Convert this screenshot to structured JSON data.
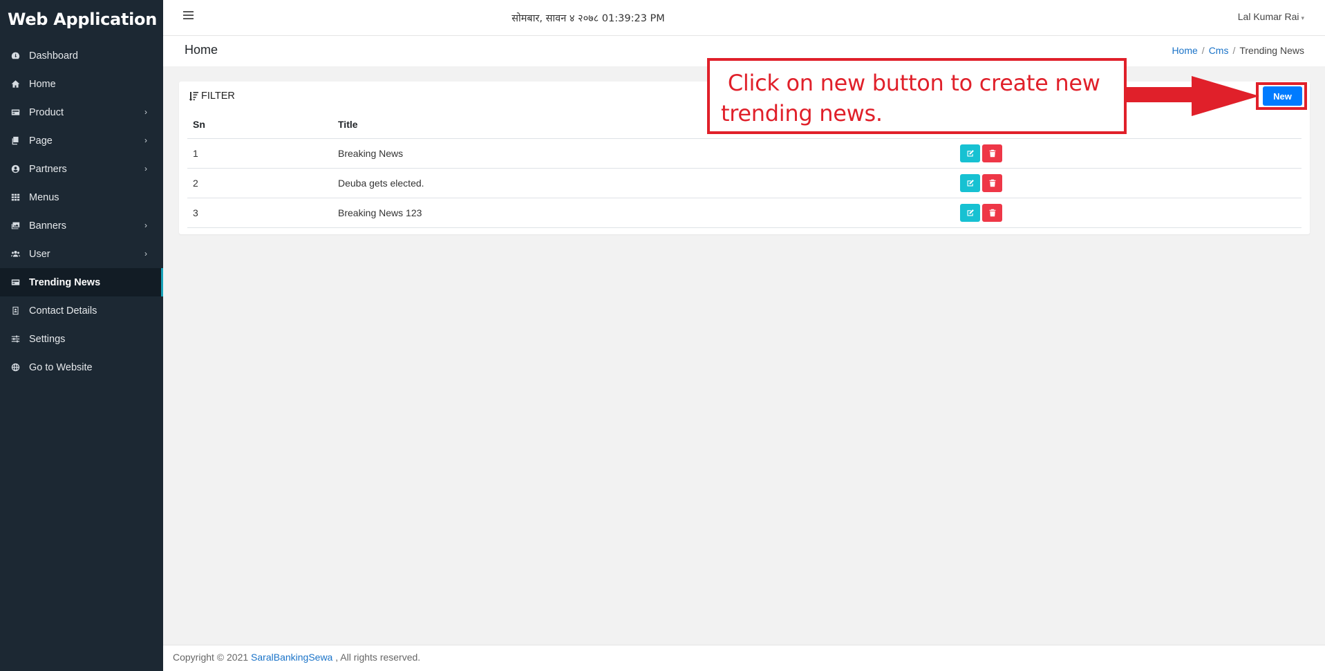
{
  "app": {
    "title": "Web Application"
  },
  "sidebar": {
    "items": [
      {
        "label": "Dashboard",
        "icon": "dashboard-icon",
        "has_children": false,
        "active": false
      },
      {
        "label": "Home",
        "icon": "home-icon",
        "has_children": false,
        "active": false
      },
      {
        "label": "Product",
        "icon": "product-icon",
        "has_children": true,
        "active": false
      },
      {
        "label": "Page",
        "icon": "page-icon",
        "has_children": true,
        "active": false
      },
      {
        "label": "Partners",
        "icon": "partners-icon",
        "has_children": true,
        "active": false
      },
      {
        "label": "Menus",
        "icon": "menus-icon",
        "has_children": false,
        "active": false
      },
      {
        "label": "Banners",
        "icon": "banners-icon",
        "has_children": true,
        "active": false
      },
      {
        "label": "User",
        "icon": "users-icon",
        "has_children": true,
        "active": false
      },
      {
        "label": "Trending News",
        "icon": "news-icon",
        "has_children": false,
        "active": true
      },
      {
        "label": "Contact Details",
        "icon": "contact-icon",
        "has_children": false,
        "active": false
      },
      {
        "label": "Settings",
        "icon": "settings-icon",
        "has_children": false,
        "active": false
      },
      {
        "label": "Go to Website",
        "icon": "globe-icon",
        "has_children": false,
        "active": false
      }
    ]
  },
  "topbar": {
    "datetime": "सोमबार, सावन ४ २०७८ 01:39:23 PM",
    "user": "Lal Kumar Rai"
  },
  "header": {
    "title": "Home",
    "breadcrumb": {
      "home": "Home",
      "cms": "Cms",
      "current": "Trending News"
    }
  },
  "card": {
    "filter_label": "FILTER",
    "new_button": "New",
    "table": {
      "headers": {
        "sn": "Sn",
        "title": "Title"
      },
      "rows": [
        {
          "sn": "1",
          "title": "Breaking News"
        },
        {
          "sn": "2",
          "title": "Deuba gets elected."
        },
        {
          "sn": "3",
          "title": "Breaking News 123"
        }
      ]
    }
  },
  "annotation": {
    "line1": " Click on new button to create new",
    "line2": "trending news."
  },
  "footer": {
    "prefix": "Copyright © 2021 ",
    "link": "SaralBankingSewa",
    "suffix": " , All rights reserved."
  },
  "colors": {
    "sidebar_bg": "#1c2833",
    "primary": "#007bff",
    "edit": "#17c1d2",
    "delete": "#ee3747",
    "annotation": "#e0202a"
  }
}
